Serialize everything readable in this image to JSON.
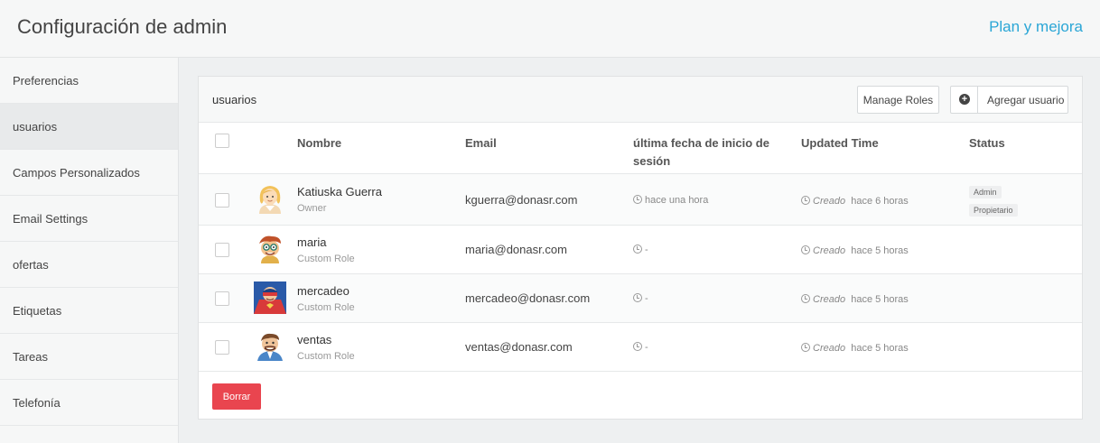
{
  "header": {
    "title": "Configuración de admin",
    "plan_link": "Plan y mejora"
  },
  "sidebar": {
    "items": [
      {
        "label": "Preferencias",
        "active": false
      },
      {
        "label": "usuarios",
        "active": true
      },
      {
        "label": "Campos Personalizados",
        "active": false
      },
      {
        "label": "Email Settings",
        "active": false
      },
      {
        "label": "ofertas",
        "active": false
      },
      {
        "label": "Etiquetas",
        "active": false
      },
      {
        "label": "Tareas",
        "active": false
      },
      {
        "label": "Telefonía",
        "active": false
      }
    ]
  },
  "panel": {
    "title": "usuarios",
    "manage_roles_label": "Manage Roles",
    "add_user_label": "Agregar usuario",
    "delete_label": "Borrar"
  },
  "table": {
    "columns": {
      "name": "Nombre",
      "email": "Email",
      "last_login": "última fecha de inicio de sesión",
      "updated": "Updated Time",
      "status": "Status"
    },
    "rows": [
      {
        "name": "Katiuska Guerra",
        "role": "Owner",
        "email": "kguerra@donasr.com",
        "last_login": "hace una hora",
        "updated_prefix": "Creado",
        "updated": "hace 6 horas",
        "badges": [
          "Admin",
          "Propietario"
        ],
        "avatar": "woman-avatar-icon"
      },
      {
        "name": "maria",
        "role": "Custom Role",
        "email": "maria@donasr.com",
        "last_login": "-",
        "updated_prefix": "Creado",
        "updated": "hace 5 horas",
        "badges": [],
        "avatar": "cartoon-boy-glasses-avatar-icon"
      },
      {
        "name": "mercadeo",
        "role": "Custom Role",
        "email": "mercadeo@donasr.com",
        "last_login": "-",
        "updated_prefix": "Creado",
        "updated": "hace 5 horas",
        "badges": [],
        "avatar": "superhero-avatar-icon"
      },
      {
        "name": "ventas",
        "role": "Custom Role",
        "email": "ventas@donasr.com",
        "last_login": "-",
        "updated_prefix": "Creado",
        "updated": "hace 5 horas",
        "badges": [],
        "avatar": "cartoon-businessman-avatar-icon"
      }
    ]
  },
  "colors": {
    "accent": "#2aa6d6",
    "danger": "#e9454f"
  }
}
